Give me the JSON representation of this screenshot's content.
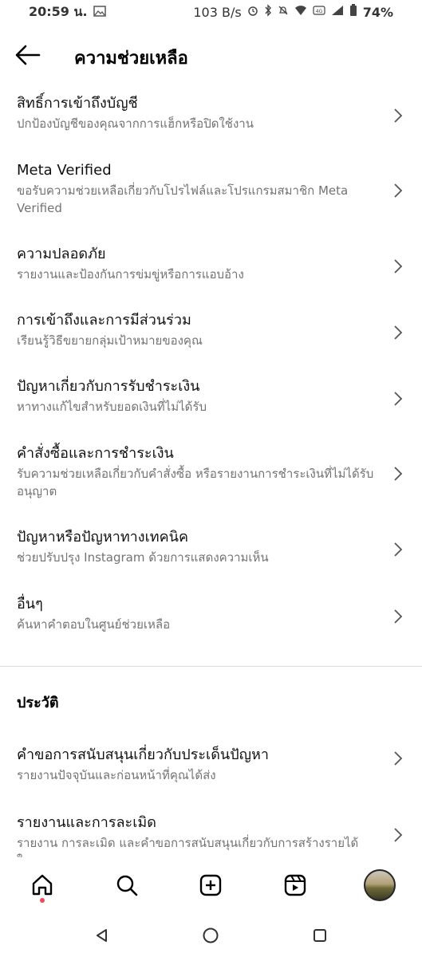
{
  "status_bar": {
    "time": "20:59 น.",
    "speed": "103 B/s",
    "network": "4G",
    "battery": "74%"
  },
  "header": {
    "title": "ความช่วยเหลือ"
  },
  "menu": [
    {
      "title": "สิทธิ์การเข้าถึงบัญชี",
      "subtitle": "ปกป้องบัญชีของคุณจากการแฮ็กหรือปิดใช้งาน"
    },
    {
      "title": "Meta Verified",
      "subtitle": "ขอรับความช่วยเหลือเกี่ยวกับโปรไฟล์และโปรแกรมสมาชิก Meta Verified"
    },
    {
      "title": "ความปลอดภัย",
      "subtitle": "รายงานและป้องกันการข่มขู่หรือการแอบอ้าง"
    },
    {
      "title": "การเข้าถึงและการมีส่วนร่วม",
      "subtitle": "เรียนรู้วิธีขยายกลุ่มเป้าหมายของคุณ"
    },
    {
      "title": "ปัญหาเกี่ยวกับการรับชำระเงิน",
      "subtitle": "หาทางแก้ไขสำหรับยอดเงินที่ไม่ได้รับ"
    },
    {
      "title": "คำสั่งซื้อและการชำระเงิน",
      "subtitle": "รับความช่วยเหลือเกี่ยวกับคำสั่งซื้อ หรือรายงานการชำระเงินที่ไม่ได้รับอนุญาต"
    },
    {
      "title": "ปัญหาหรือปัญหาทางเทคนิค",
      "subtitle": "ช่วยปรับปรุง Instagram ด้วยการแสดงความเห็น"
    },
    {
      "title": "อื่นๆ",
      "subtitle": "ค้นหาคำตอบในศูนย์ช่วยเหลือ"
    }
  ],
  "history": {
    "title": "ประวัติ",
    "items": [
      {
        "title": "คำขอการสนับสนุนเกี่ยวกับประเด็นปัญหา",
        "subtitle": "รายงานปัจจุบันและก่อนหน้าที่คุณได้ส่ง"
      },
      {
        "title": "รายงานและการละเมิด",
        "subtitle": "รายงาน การละเมิด และคำขอการสนับสนุนเกี่ยวกับการสร้างรายได้ใดๆ"
      }
    ]
  },
  "colors": {
    "secondary_text": "#737373",
    "divider": "#dbdbdb",
    "notification_dot": "#ed4956"
  },
  "bottom_nav": [
    "home-icon",
    "search-icon",
    "create-icon",
    "reels-icon",
    "profile-avatar"
  ]
}
